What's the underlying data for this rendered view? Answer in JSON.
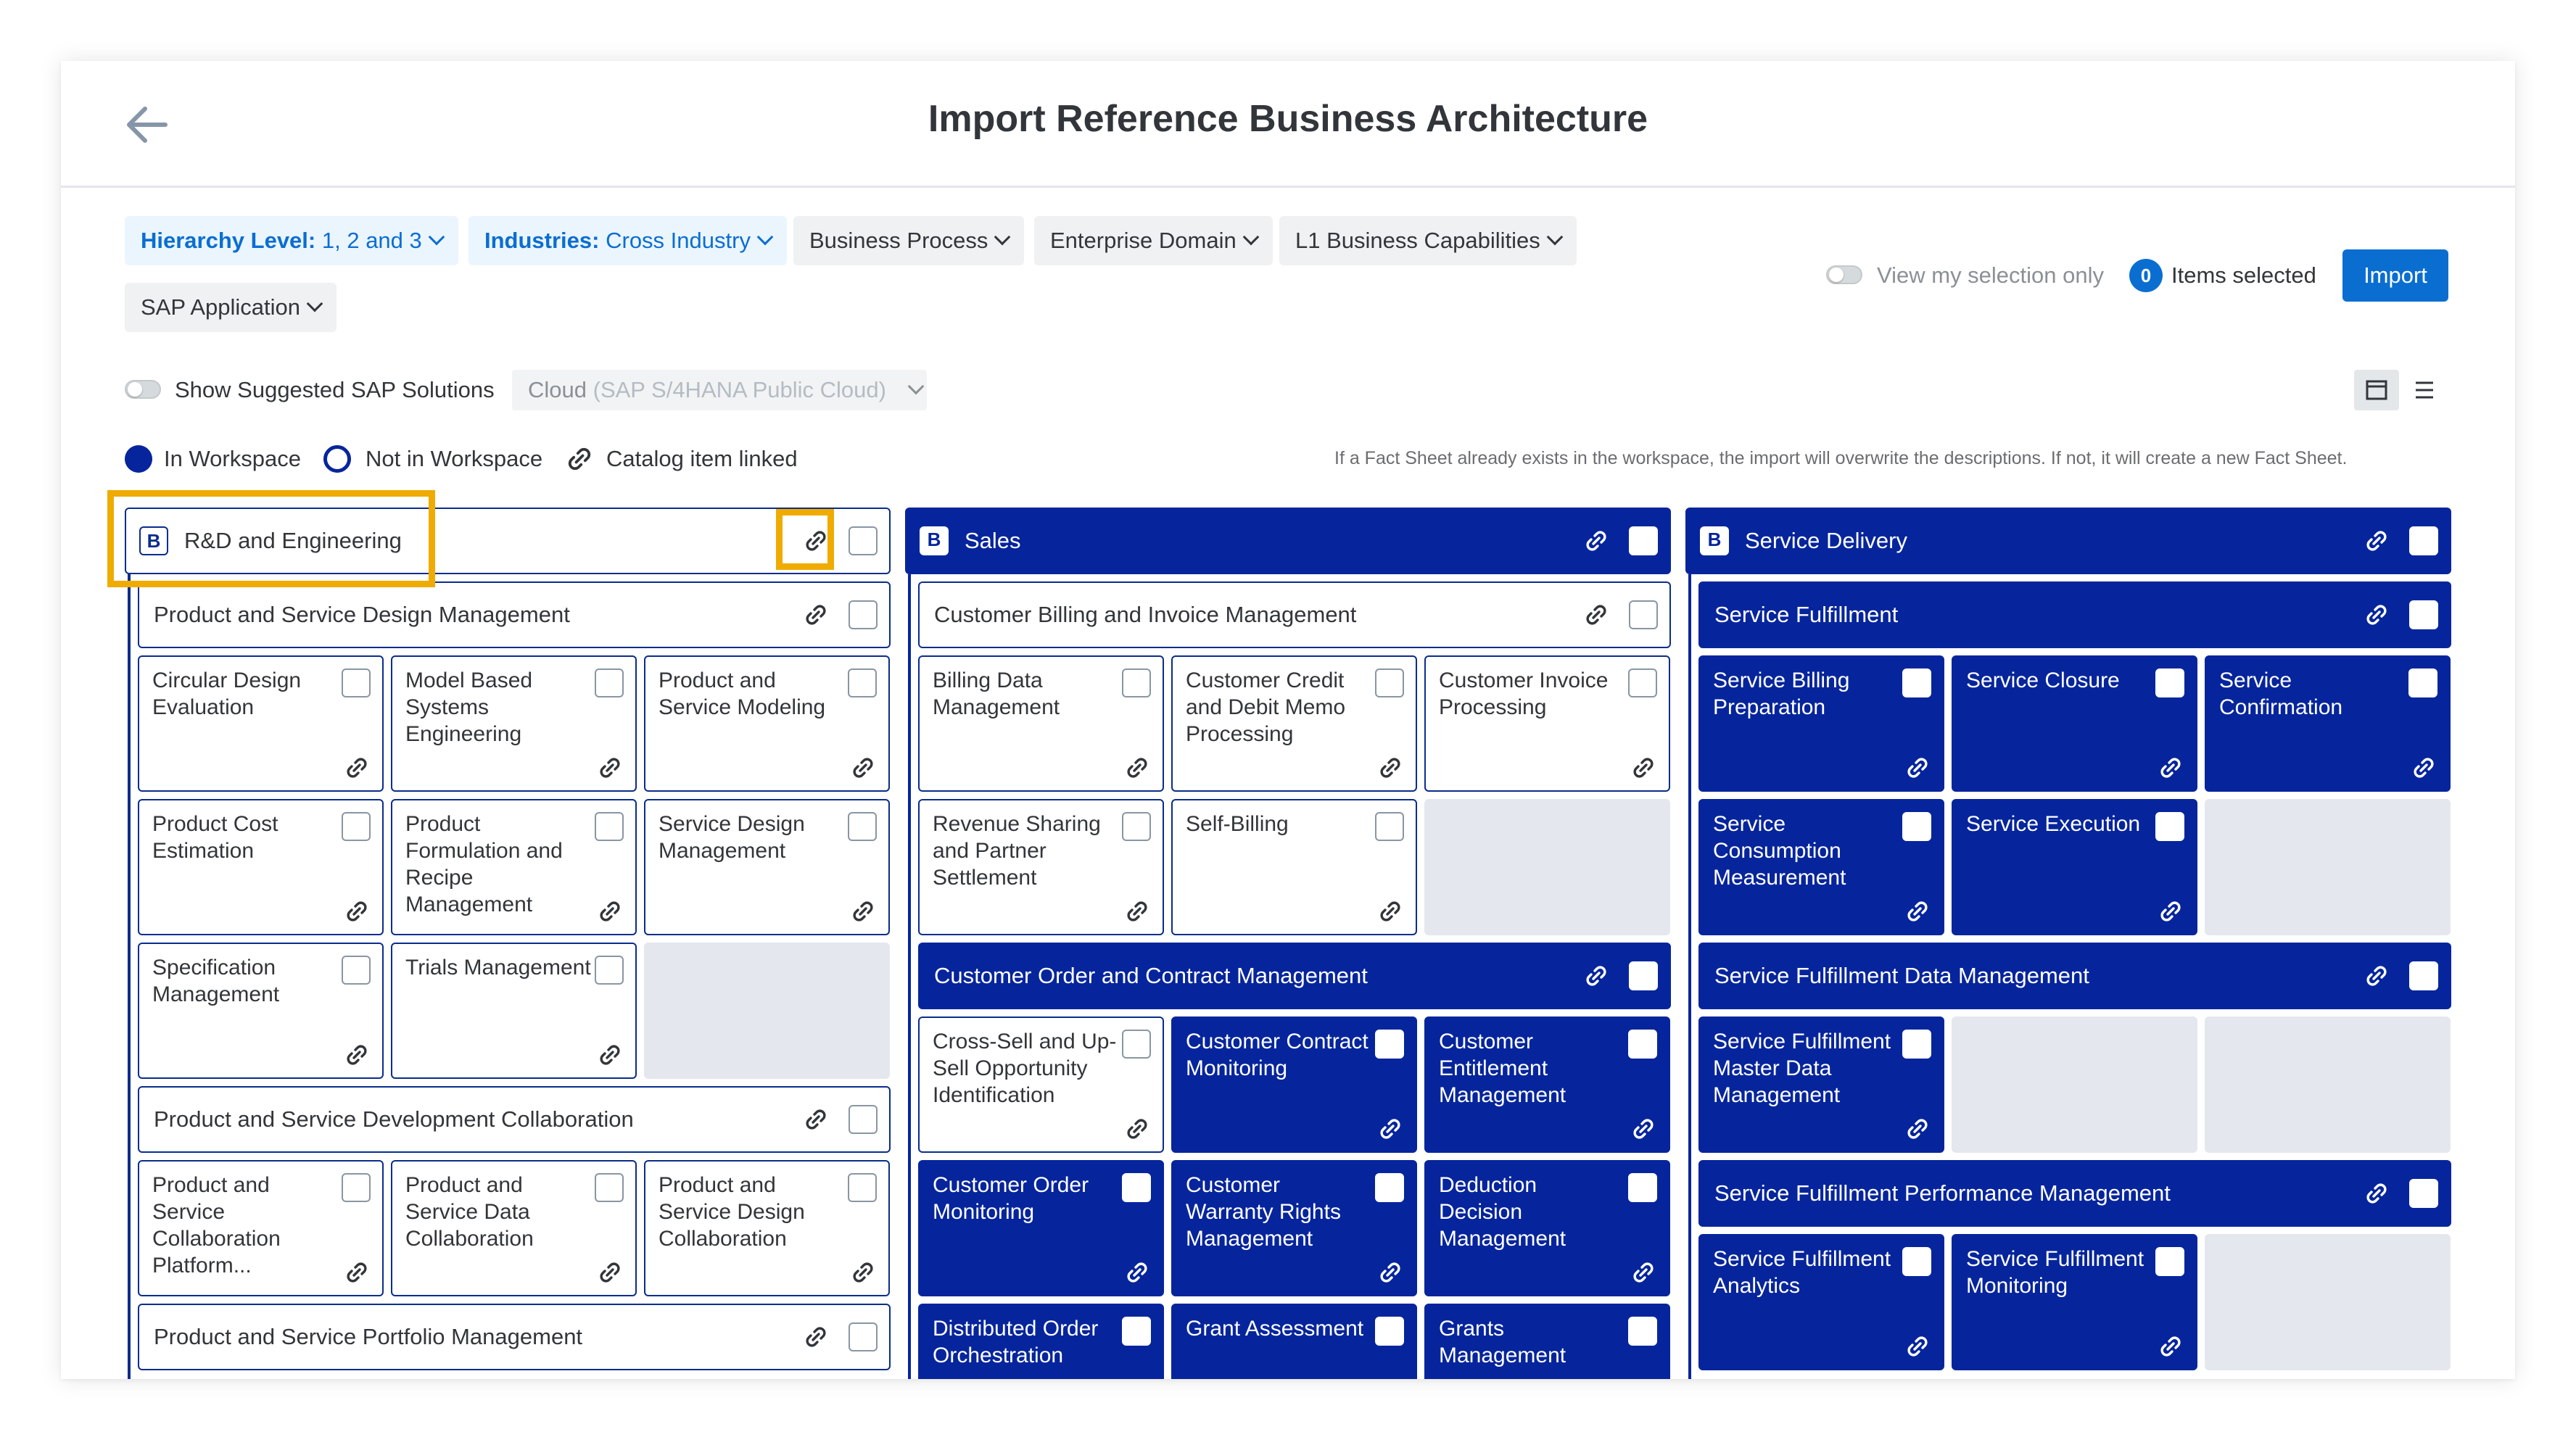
{
  "header": {
    "title": "Import Reference Business Architecture"
  },
  "filters": [
    {
      "key": "Hierarchy Level",
      "value": "1, 2 and 3",
      "active": true
    },
    {
      "key": "Industries",
      "value": "Cross Industry",
      "active": true
    },
    {
      "label": "Business Process",
      "active": false
    },
    {
      "label": "Enterprise Domain",
      "active": false
    },
    {
      "label": "L1 Business Capabilities",
      "active": false
    },
    {
      "label": "SAP Application",
      "active": false
    }
  ],
  "selection": {
    "view_my_selection_label": "View my selection only",
    "count": "0",
    "items_selected_label": "Items selected",
    "import_label": "Import"
  },
  "suggested": {
    "toggle_label": "Show Suggested SAP Solutions",
    "cloud_prefix": "Cloud",
    "cloud_value": "(SAP S/4HANA Public Cloud)"
  },
  "legend": {
    "in_workspace": "In Workspace",
    "not_in_workspace": "Not in Workspace",
    "catalog_linked": "Catalog item linked",
    "note": "If a Fact Sheet already exists in the workspace, the import will overwrite the descriptions. If not, it will create a new Fact Sheet."
  },
  "colors": {
    "accent": "#0a6ed1",
    "in_workspace": "#06259c",
    "highlight": "#f0ab00",
    "empty_slot": "#e5e7ee"
  },
  "icons": {
    "back": "arrow-left-icon",
    "link": "link-icon",
    "chevron": "chevron-down-icon",
    "view_card": "card-view-icon",
    "view_list": "list-view-icon"
  },
  "columns": [
    {
      "title": "R&D and Engineering",
      "badge": "B",
      "in_workspace": false,
      "groups": [
        {
          "title": "Product and Service Design Management",
          "in_workspace": false,
          "items": [
            {
              "label": "Circular Design Evaluation",
              "in_workspace": false
            },
            {
              "label": "Model Based Systems Engineering",
              "in_workspace": false
            },
            {
              "label": "Product and Service Modeling",
              "in_workspace": false
            },
            {
              "label": "Product Cost Estimation",
              "in_workspace": false
            },
            {
              "label": "Product Formulation and Recipe Management",
              "in_workspace": false
            },
            {
              "label": "Service Design Management",
              "in_workspace": false
            },
            {
              "label": "Specification Management",
              "in_workspace": false
            },
            {
              "label": "Trials Management",
              "in_workspace": false
            }
          ]
        },
        {
          "title": "Product and Service Development Collaboration",
          "in_workspace": false,
          "items": [
            {
              "label": "Product and Service Collaboration Platform...",
              "in_workspace": false
            },
            {
              "label": "Product and Service Data Collaboration",
              "in_workspace": false
            },
            {
              "label": "Product and Service Design Collaboration",
              "in_workspace": false
            }
          ]
        },
        {
          "title": "Product and Service Portfolio Management",
          "in_workspace": false,
          "items": []
        }
      ]
    },
    {
      "title": "Sales",
      "badge": "B",
      "in_workspace": true,
      "groups": [
        {
          "title": "Customer Billing and Invoice Management",
          "in_workspace": false,
          "items": [
            {
              "label": "Billing Data Management",
              "in_workspace": false
            },
            {
              "label": "Customer Credit and Debit Memo Processing",
              "in_workspace": false
            },
            {
              "label": "Customer Invoice Processing",
              "in_workspace": false
            },
            {
              "label": "Revenue Sharing and Partner Settlement",
              "in_workspace": false
            },
            {
              "label": "Self-Billing",
              "in_workspace": false
            }
          ]
        },
        {
          "title": "Customer Order and Contract Management",
          "in_workspace": true,
          "items": [
            {
              "label": "Cross-Sell and Up-Sell Opportunity Identification",
              "in_workspace": false
            },
            {
              "label": "Customer Contract Monitoring",
              "in_workspace": true
            },
            {
              "label": "Customer Entitlement Management",
              "in_workspace": true
            },
            {
              "label": "Customer Order Monitoring",
              "in_workspace": true
            },
            {
              "label": "Customer Warranty Rights Management",
              "in_workspace": true
            },
            {
              "label": "Deduction Decision Management",
              "in_workspace": true
            },
            {
              "label": "Distributed Order Orchestration",
              "in_workspace": true
            },
            {
              "label": "Grant Assessment",
              "in_workspace": true
            },
            {
              "label": "Grants Management",
              "in_workspace": true
            }
          ]
        }
      ]
    },
    {
      "title": "Service Delivery",
      "badge": "B",
      "in_workspace": true,
      "groups": [
        {
          "title": "Service Fulfillment",
          "in_workspace": true,
          "items": [
            {
              "label": "Service Billing Preparation",
              "in_workspace": true
            },
            {
              "label": "Service Closure",
              "in_workspace": true
            },
            {
              "label": "Service Confirmation",
              "in_workspace": true
            },
            {
              "label": "Service Consumption Measurement",
              "in_workspace": true
            },
            {
              "label": "Service Execution",
              "in_workspace": true
            }
          ]
        },
        {
          "title": "Service Fulfillment Data Management",
          "in_workspace": true,
          "items": [
            {
              "label": "Service Fulfillment Master Data Management",
              "in_workspace": true
            }
          ]
        },
        {
          "title": "Service Fulfillment Performance Management",
          "in_workspace": true,
          "items": [
            {
              "label": "Service Fulfillment Analytics",
              "in_workspace": true
            },
            {
              "label": "Service Fulfillment Monitoring",
              "in_workspace": true
            }
          ]
        }
      ]
    }
  ]
}
